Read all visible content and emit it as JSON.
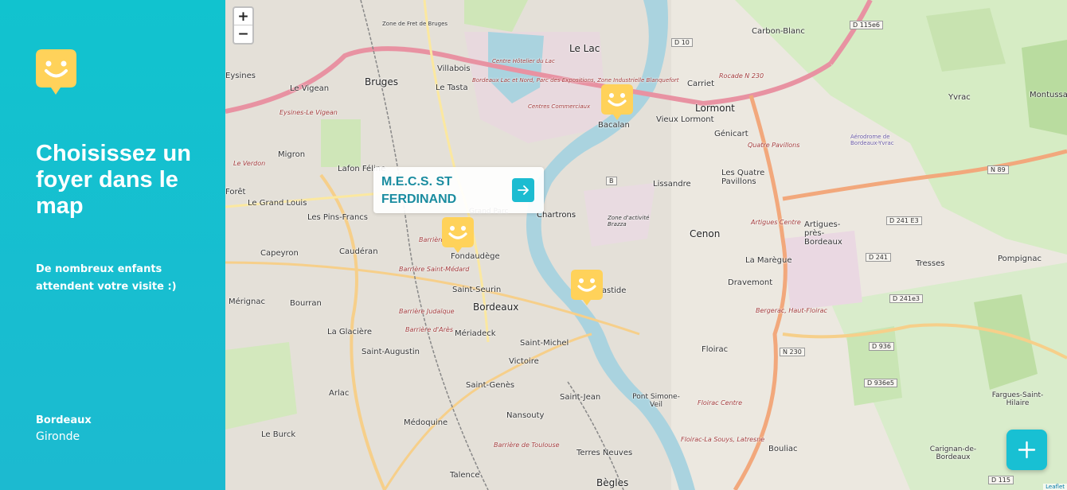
{
  "sidebar": {
    "logo_icon": "smiley-speech-bubble-icon",
    "headline": "Choisissez un foyer dans le map",
    "subtitle": "De nombreux enfants attendent votre visite :)",
    "city": "Bordeaux",
    "region": "Gironde"
  },
  "map": {
    "zoom_in": "+",
    "zoom_out": "−",
    "popup": {
      "title": "M.E.C.S. ST FERDINAND",
      "button_icon": "arrow-right-icon"
    },
    "fab_icon": "plus-icon",
    "attribution": "Leaflet",
    "labels": {
      "blanquefort": "Zone de Fret de Bruges",
      "bruges": "Bruges",
      "le_lac": "Le Lac",
      "villabois": "Villabois",
      "le_vigean": "Le Vigean",
      "le_tasta": "Le Tasta",
      "eysines": "Eysines",
      "bacalan": "Bacalan",
      "carriet": "Carriet",
      "lormont": "Lormont",
      "vieux_lormont": "Vieux Lormont",
      "genicart": "Génicart",
      "carbon_blanc": "Carbon-Blanc",
      "yvrac": "Yvrac",
      "montussan": "Montussan",
      "migron": "Migron",
      "lafon_feline": "Lafon Féline",
      "foret": "Forêt",
      "le_grand_louis": "Le Grand Louis",
      "les_pins_francs": "Les Pins-Francs",
      "chartrons": "Chartrons",
      "lissandre": "Lissandre",
      "quatre_pavillons": "Les Quatre Pavillons",
      "artigues": "Artigues-près-Bordeaux",
      "cenon": "Cenon",
      "la_maregue": "La Marègue",
      "tresses": "Tresses",
      "pompignac": "Pompignac",
      "capeyron": "Capeyron",
      "cauderan": "Caudéran",
      "fondaudege": "Fondaudège",
      "saint_seurin": "Saint-Seurin",
      "bordeaux": "Bordeaux",
      "dravemont": "Dravemont",
      "merignac": "Mérignac",
      "bourran": "Bourran",
      "la_glaciere": "La Glacière",
      "meriadeck": "Mériadeck",
      "saint_michel": "Saint-Michel",
      "saint_augustin": "Saint-Augustin",
      "victoire": "Victoire",
      "floirac": "Floirac",
      "arlac": "Arlac",
      "saint_genes": "Saint-Genès",
      "saint_jean": "Saint-Jean",
      "pont_simone_veil": "Pont Simone-Veil",
      "fargues": "Fargues-Saint-Hilaire",
      "medoquine": "Médoquine",
      "nansouty": "Nansouty",
      "le_burck": "Le Burck",
      "bouliac": "Bouliac",
      "carignan": "Carignan-de-Bordeaux",
      "terres_neuves": "Terres Neuves",
      "talence": "Talence",
      "begles": "Bègles",
      "aerodrome": "Aérodrome de Bordeaux-Yvrac",
      "bastide": "Bastide",
      "grand_parc": "Grand Parc",
      "zone_brazza": "Zone d'activité Brazza",
      "d10": "D 10",
      "d115e6": "D 115e6",
      "d241e3": "D 241 E3",
      "d241": "D 241",
      "d241e3b": "D 241e3",
      "d936": "D 936",
      "d936e5": "D 936e5",
      "n89": "N 89",
      "n230": "N 230",
      "d115": "D 115",
      "b": "B",
      "rocade": "Rocade N 230",
      "barriere": "Barrière",
      "barriere_st_medard": "Barrière Saint-Médard",
      "barriere_judaique": "Barrière Judaïque",
      "barriere_ares": "Barrière d'Arès",
      "barriere_toulouse": "Barrière de Toulouse",
      "bordeaux_lac": "Bordeaux Lac et Nord, Parc des Expositions, Zone Industrielle Blanquefort",
      "centre_hotelier": "Centre Hôtelier du Lac",
      "centres_commerciaux": "Centres Commerciaux",
      "artigues_centre": "Artigues Centre",
      "quatre_pavillons_exit": "Quatre Pavillons",
      "bergerac": "Bergerac, Haut-Floirac",
      "floirac_centre": "Floirac Centre",
      "floirac_la_souys": "Floirac-La Souys, Latresne",
      "eysines_vigean": "Eysines-Le Vigean",
      "le_verdon": "Le Verdon"
    }
  },
  "colors": {
    "accent": "#1cbcd1",
    "marker": "#ffd25a",
    "water": "#aad3df"
  }
}
